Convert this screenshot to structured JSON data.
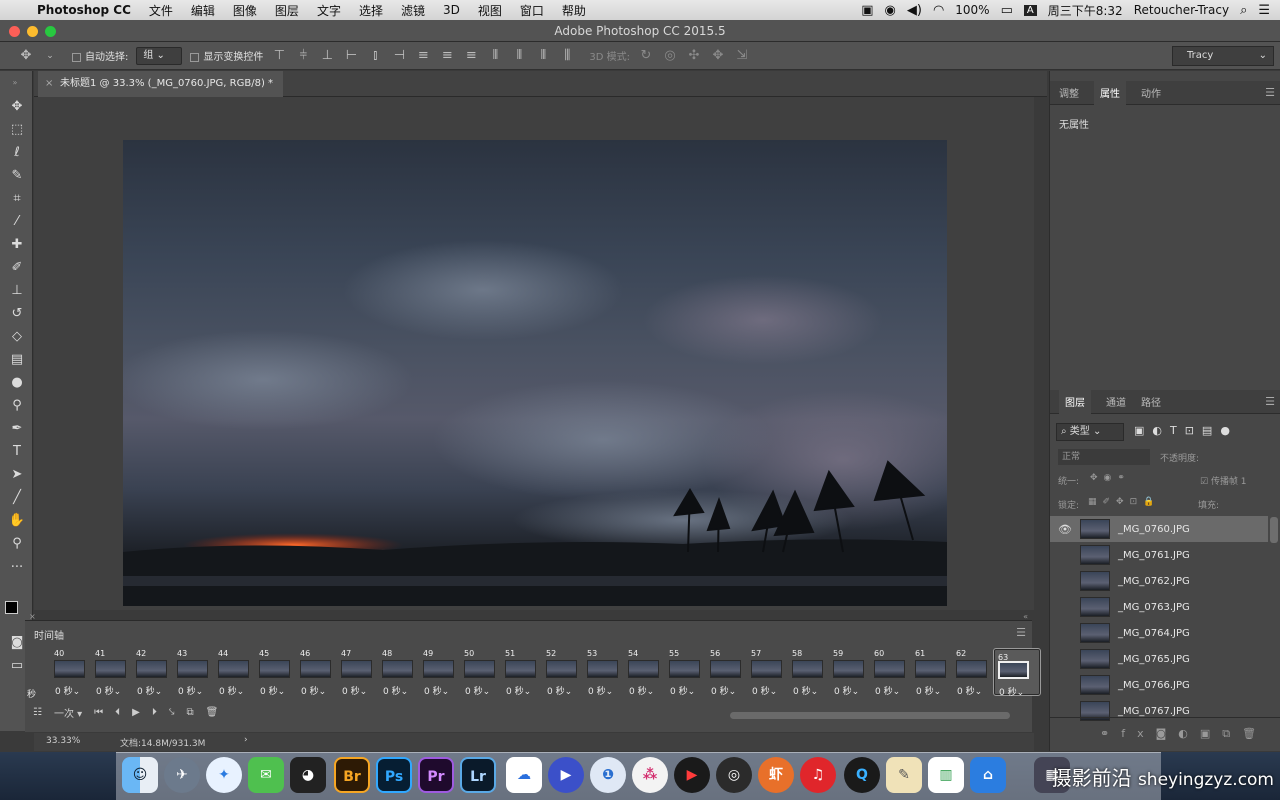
{
  "menubar": {
    "app": "Photoshop CC",
    "items": [
      "文件",
      "编辑",
      "图像",
      "图层",
      "文字",
      "选择",
      "滤镜",
      "3D",
      "视图",
      "窗口",
      "帮助"
    ],
    "battery": "100%",
    "clock": "周三下午8:32",
    "user": "Retoucher-Tracy",
    "input_badge": "A"
  },
  "window": {
    "title": "Adobe Photoshop CC 2015.5"
  },
  "options": {
    "auto_select_label": "自动选择:",
    "auto_select_value": "组",
    "transform_label": "显示变换控件",
    "mode_3d": "3D 模式:",
    "workspace": "Tracy"
  },
  "document": {
    "tab_title": "未标题1 @ 33.3% (_MG_0760.JPG, RGB/8) *",
    "close": "×"
  },
  "timeline": {
    "title": "时间轴",
    "first_partial_duration": "秒",
    "frames": [
      {
        "n": "40",
        "d": "0 秒"
      },
      {
        "n": "41",
        "d": "0 秒"
      },
      {
        "n": "42",
        "d": "0 秒"
      },
      {
        "n": "43",
        "d": "0 秒"
      },
      {
        "n": "44",
        "d": "0 秒"
      },
      {
        "n": "45",
        "d": "0 秒"
      },
      {
        "n": "46",
        "d": "0 秒"
      },
      {
        "n": "47",
        "d": "0 秒"
      },
      {
        "n": "48",
        "d": "0 秒"
      },
      {
        "n": "49",
        "d": "0 秒"
      },
      {
        "n": "50",
        "d": "0 秒"
      },
      {
        "n": "51",
        "d": "0 秒"
      },
      {
        "n": "52",
        "d": "0 秒"
      },
      {
        "n": "53",
        "d": "0 秒"
      },
      {
        "n": "54",
        "d": "0 秒"
      },
      {
        "n": "55",
        "d": "0 秒"
      },
      {
        "n": "56",
        "d": "0 秒"
      },
      {
        "n": "57",
        "d": "0 秒"
      },
      {
        "n": "58",
        "d": "0 秒"
      },
      {
        "n": "59",
        "d": "0 秒"
      },
      {
        "n": "60",
        "d": "0 秒"
      },
      {
        "n": "61",
        "d": "0 秒"
      },
      {
        "n": "62",
        "d": "0 秒"
      },
      {
        "n": "63",
        "d": "0 秒"
      }
    ],
    "loop": "一次"
  },
  "status": {
    "zoom": "33.33%",
    "doc": "文档:14.8M/931.3M"
  },
  "panels": {
    "top_tabs": [
      "调整",
      "属性",
      "动作"
    ],
    "no_properties": "无属性",
    "layer_tabs": [
      "图层",
      "通道",
      "路径"
    ],
    "kind": "类型",
    "blend": "正常",
    "opacity_label": "不透明度:",
    "unify": "统一:",
    "propagate": "传播帧 1",
    "lock": "锁定:",
    "fill": "填充:",
    "layers": [
      "_MG_0760.JPG",
      "_MG_0761.JPG",
      "_MG_0762.JPG",
      "_MG_0763.JPG",
      "_MG_0764.JPG",
      "_MG_0765.JPG",
      "_MG_0766.JPG",
      "_MG_0767.JPG"
    ]
  },
  "dock": {
    "apps": [
      "Br",
      "Ps",
      "Pr",
      "Lr"
    ]
  },
  "watermark": {
    "cn": "摄影前沿",
    "url": "sheyingzyz.com"
  }
}
